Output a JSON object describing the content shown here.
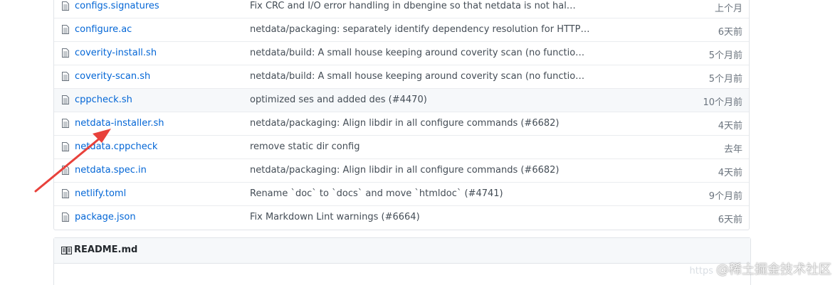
{
  "files": [
    {
      "name": "configs.signatures",
      "message": "Fix CRC and I/O error handling in dbengine so that netdata is not hal…",
      "age": "上个月"
    },
    {
      "name": "configure.ac",
      "message": "netdata/packaging: separately identify dependency resolution for HTTP…",
      "age": "6天前"
    },
    {
      "name": "coverity-install.sh",
      "message": "netdata/build: A small house keeping around coverity scan (no functio…",
      "age": "5个月前"
    },
    {
      "name": "coverity-scan.sh",
      "message": "netdata/build: A small house keeping around coverity scan (no functio…",
      "age": "5个月前"
    },
    {
      "name": "cppcheck.sh",
      "message": "optimized ses and added des (#4470)",
      "age": "10个月前"
    },
    {
      "name": "netdata-installer.sh",
      "message": "netdata/packaging: Align libdir in all configure commands (#6682)",
      "age": "4天前"
    },
    {
      "name": "netdata.cppcheck",
      "message": "remove static dir config",
      "age": "去年"
    },
    {
      "name": "netdata.spec.in",
      "message": "netdata/packaging: Align libdir in all configure commands (#6682)",
      "age": "4天前"
    },
    {
      "name": "netlify.toml",
      "message": "Rename `doc` to `docs` and move `htmldoc` (#4741)",
      "age": "9个月前"
    },
    {
      "name": "package.json",
      "message": "Fix Markdown Lint warnings (#6664)",
      "age": "6天前"
    }
  ],
  "readme": {
    "title": "README.md"
  },
  "watermark": {
    "url": "https",
    "text": "@稀土掘金技术社区"
  },
  "colors": {
    "link": "#0366d6",
    "annotation_arrow": "#e8413b",
    "row_hover": "#f6f8fa"
  }
}
